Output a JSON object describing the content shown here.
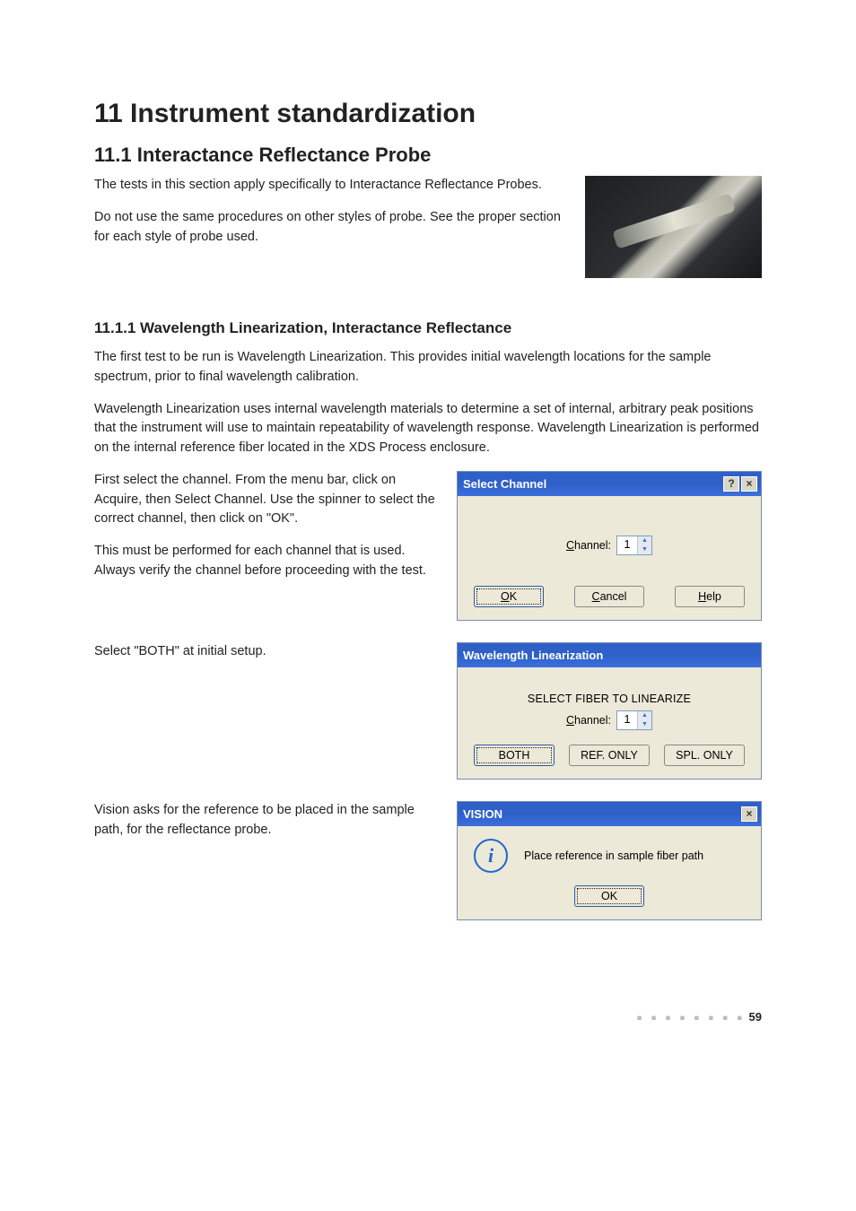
{
  "chapter": {
    "title": "11 Instrument standardization"
  },
  "section11_1": {
    "title": "11.1 Interactance Reflectance Probe",
    "p1": "The tests in this section apply specifically to Interactance Reflectance Probes.",
    "p2": "Do not use the same procedures on other styles of probe. See the proper section for each style of probe used."
  },
  "section11_1_1": {
    "title": "11.1.1  Wavelength Linearization, Interactance Reflectance",
    "p1": "The first test to be run is Wavelength Linearization. This provides initial wavelength locations for the sample spectrum, prior to final wavelength calibration.",
    "p2": "Wavelength Linearization uses internal wavelength materials to determine a set of internal, arbitrary peak positions that the instrument will use to maintain repeatability of wavelength response. Wavelength Linearization is performed on the internal reference fiber located in the XDS Process enclosure.",
    "p3": "First select the channel. From the menu bar, click on Acquire, then Select Channel. Use the spinner to select the correct channel, then click on \"OK\".",
    "p4": "This must be performed for each channel that is used. Always verify the channel before proceeding with the test.",
    "p5": "Select \"BOTH\" at initial setup.",
    "p6": "Vision asks for the reference to be placed in the sample path, for the reflectance probe."
  },
  "dialog1": {
    "title": "Select Channel",
    "help_btn": "?",
    "close_btn": "×",
    "channel_label_pre": "C",
    "channel_label_post": "hannel:",
    "channel_value": "1",
    "btn_ok_pre": "O",
    "btn_ok_post": "K",
    "btn_cancel_pre": "C",
    "btn_cancel_post": "ancel",
    "btn_help_pre": "H",
    "btn_help_post": "elp"
  },
  "dialog2": {
    "title": "Wavelength Linearization",
    "body_text": "SELECT FIBER TO LINEARIZE",
    "channel_label_pre": "C",
    "channel_label_post": "hannel:",
    "channel_value": "1",
    "btn_both": "BOTH",
    "btn_ref": "REF. ONLY",
    "btn_spl": "SPL. ONLY"
  },
  "dialog3": {
    "title": "VISION",
    "close_btn": "×",
    "message": "Place reference in sample fiber path",
    "info_glyph": "i",
    "btn_ok": "OK"
  },
  "footer": {
    "dots": "■ ■ ■ ■ ■ ■ ■ ■",
    "page": "59"
  }
}
